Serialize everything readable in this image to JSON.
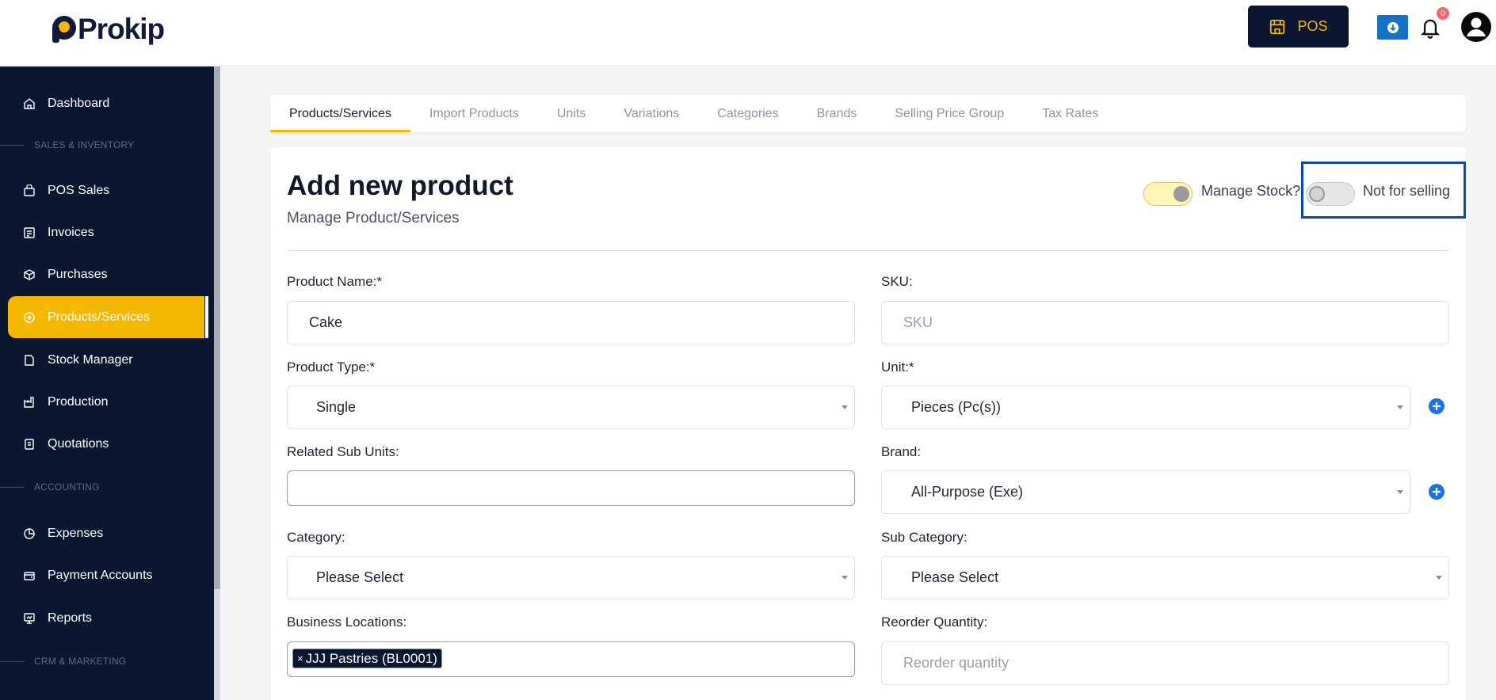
{
  "header": {
    "logo_text": "Prokip",
    "pos_label": "POS",
    "notification_count": "0"
  },
  "sidebar": {
    "items": [
      {
        "label": "Dashboard",
        "icon": "home-icon"
      },
      {
        "label": "POS Sales",
        "icon": "bag-icon"
      },
      {
        "label": "Invoices",
        "icon": "invoice-icon"
      },
      {
        "label": "Purchases",
        "icon": "box-icon"
      },
      {
        "label": "Products/Services",
        "icon": "product-icon"
      },
      {
        "label": "Stock Manager",
        "icon": "stock-icon"
      },
      {
        "label": "Production",
        "icon": "factory-icon"
      },
      {
        "label": "Quotations",
        "icon": "quotation-icon"
      },
      {
        "label": "Expenses",
        "icon": "pie-icon"
      },
      {
        "label": "Payment Accounts",
        "icon": "wallet-icon"
      },
      {
        "label": "Reports",
        "icon": "report-icon"
      }
    ],
    "sections": [
      "SALES & INVENTORY",
      "ACCOUNTING",
      "CRM & MARKETING"
    ]
  },
  "tabs": [
    "Products/Services",
    "Import Products",
    "Units",
    "Variations",
    "Categories",
    "Brands",
    "Selling Price Group",
    "Tax Rates"
  ],
  "form": {
    "title": "Add new product",
    "subtitle": "Manage Product/Services",
    "manage_stock_label": "Manage Stock?",
    "manage_stock_on": true,
    "not_for_selling_label": "Not for selling",
    "not_for_selling_on": false,
    "product_name_label": "Product Name:*",
    "product_name_value": "Cake",
    "sku_label": "SKU:",
    "sku_placeholder": "SKU",
    "product_type_label": "Product Type:*",
    "product_type_value": "Single",
    "unit_label": "Unit:*",
    "unit_value": "Pieces (Pc(s))",
    "related_sub_units_label": "Related Sub Units:",
    "brand_label": "Brand:",
    "brand_value": "All-Purpose (Exe)",
    "category_label": "Category:",
    "category_value": "Please Select",
    "sub_category_label": "Sub Category:",
    "sub_category_value": "Please Select",
    "business_locations_label": "Business Locations:",
    "business_location_tag": "JJJ Pastries (BL0001)",
    "reorder_quantity_label": "Reorder Quantity:",
    "reorder_quantity_placeholder": "Reorder quantity"
  },
  "colors": {
    "sidebar_bg": "#0b1731",
    "accent": "#f5b800",
    "highlight": "#0a4ba8",
    "add_icon": "#1a73e8"
  }
}
